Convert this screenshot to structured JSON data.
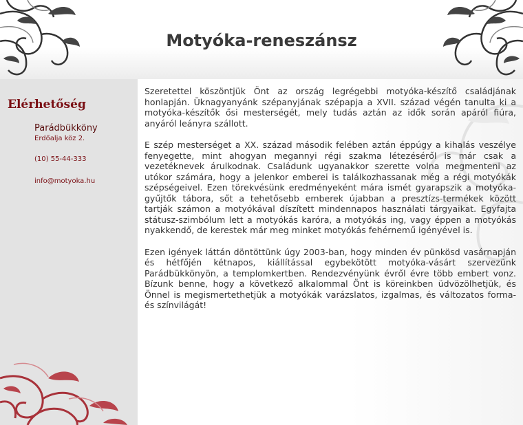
{
  "header": {
    "title": "Motyóka-reneszánsz"
  },
  "sidebar": {
    "heading": "Elérhetőség",
    "town": "Parádbükköny",
    "street": "Erdőalja köz 2.",
    "phone": "(10) 55-44-333",
    "email": "info@motyoka.hu"
  },
  "content": {
    "paragraphs": [
      "Szeretettel köszöntjük Önt az ország legrégebbi motyóka-készítő családjának honlapján. Üknagyanyánk szépanyjának szépapja a XVII. század végén tanulta ki a motyóka-készítők ősi mesterségét, mely tudás aztán az idők során apáról fiúra, anyáról leányra szállott.",
      "E szép mesterséget a XX. század második felében aztán éppúgy a kihalás veszélye fenyegette, mint ahogyan megannyi régi szakma létezéséről is már csak a vezetéknevek árulkodnak. Családunk ugyanakkor szerette volna megmenteni az utókor számára, hogy a jelenkor emberei is találkozhassanak még a régi motyókák szépségeivel. Ezen törekvésünk eredményeként mára ismét gyarapszik a motyóka-gyűjtők tábora, sőt a tehetősebb emberek újabban a presztízs-termékek között tartják számon a motyókával díszített mindennapos használati tárgyaikat. Egyfajta státusz-szimbólum lett a motyókás karóra, a motyókás ing, vagy éppen a motyókás nyakkendő, de kerestek már meg minket motyókás fehérnemű igényével is.",
      "Ezen igények láttán döntöttünk úgy 2003-ban, hogy minden év pünkösd vasárnapján és hétfőjén kétnapos, kiállítással egybekötött motyóka-vásárt szervezünk Parádbükkönyön, a templomkertben. Rendezvényünk évről évre több embert vonz. Bízunk benne, hogy a következő alkalommal Önt is köreinkben üdvözölhetjük, és Önnel is megismertethetjük a motyókák varázslatos, izgalmas, és változatos forma- és színvilágát!"
    ]
  },
  "colors": {
    "accent": "#7a0f14",
    "sidebar_bg": "#e3e3e3",
    "title": "#3a3a3a",
    "ornament_red": "#a8323a",
    "ornament_gray": "#555555"
  }
}
